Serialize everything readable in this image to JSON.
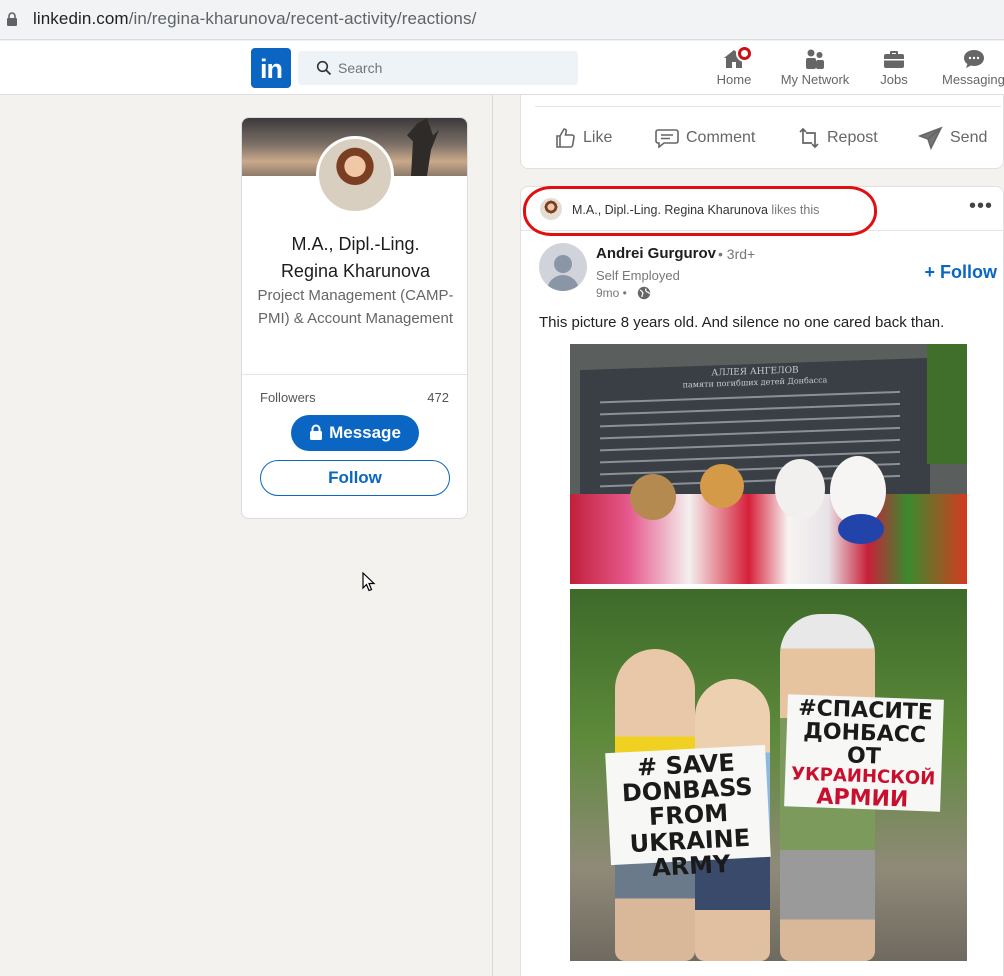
{
  "browser": {
    "url_domain": "linkedin.com",
    "url_path": "/in/regina-kharunova/recent-activity/reactions/"
  },
  "header": {
    "logo": "in",
    "search_placeholder": "Search",
    "nav": {
      "home": "Home",
      "network": "My Network",
      "jobs": "Jobs",
      "messaging": "Messaging"
    },
    "colors": {
      "brand": "#0a66c2",
      "notification": "#cc1016"
    }
  },
  "profile": {
    "name_line1": "M.A., Dipl.-Ling.",
    "name_line2": "Regina Kharunova",
    "headline": "Project Management (CAMP-PMI) & Account Management",
    "followers_label": "Followers",
    "followers_count": "472",
    "message_button": "Message",
    "follow_button": "Follow"
  },
  "prev_post_actions": {
    "like": "Like",
    "comment": "Comment",
    "repost": "Repost",
    "send": "Send"
  },
  "post": {
    "liker_name": "M.A., Dipl.-Ling. Regina Kharunova",
    "liker_action": "likes this",
    "more": "•••",
    "author_name": "Andrei Gurgurov",
    "author_degree": "• 3rd+",
    "author_subtitle": "Self Employed",
    "time": "9mo •",
    "follow_link": "+ Follow",
    "text": "This picture 8 years old. And silence no one cared back than.",
    "photo1": {
      "plaque_title": "АЛЛЕЯ АНГЕЛОВ",
      "plaque_subtitle": "памяти погибших детей Донбасса"
    },
    "photo2": {
      "sign1_lines": [
        "# SAVE",
        "DONBASS",
        "FROM",
        "UKRAINE",
        "ARMY"
      ],
      "sign2_lines": [
        "#СПАСИТЕ",
        "ДОНБАСС",
        "ОТ",
        "УКРАИНСКОЙ",
        "АРМИИ"
      ]
    }
  }
}
